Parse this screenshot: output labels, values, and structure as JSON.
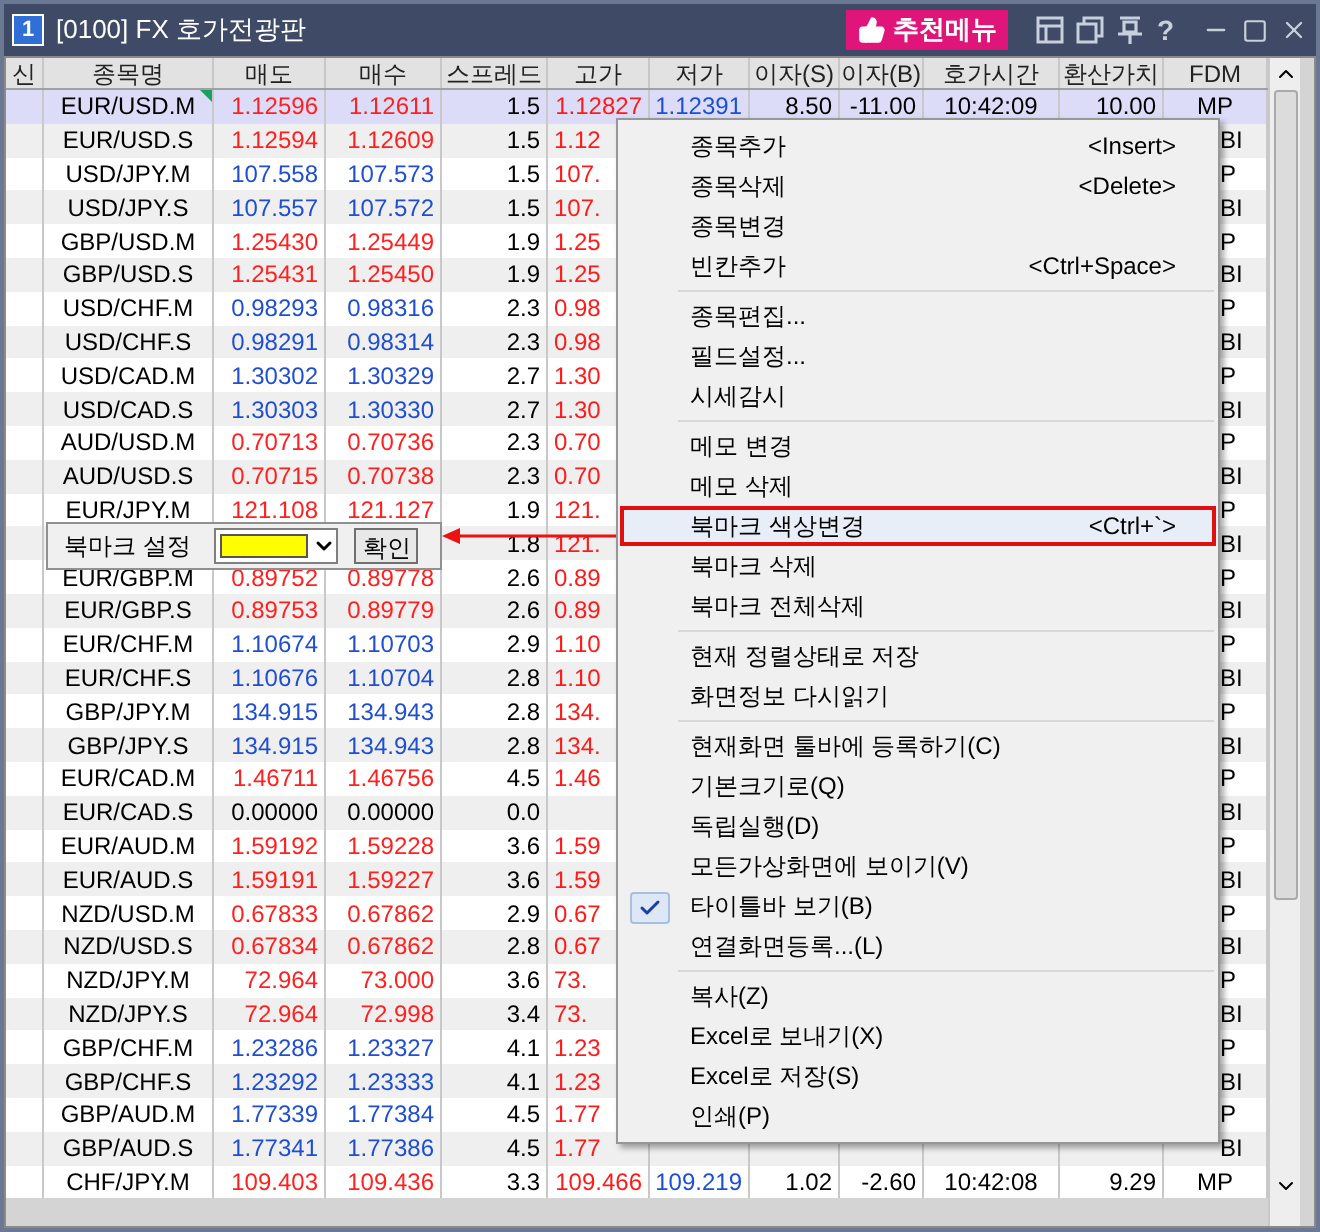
{
  "window": {
    "number": "1",
    "title": "[0100] FX 호가전광판",
    "recommend_button": "추천메뉴",
    "help_glyph": "?"
  },
  "table": {
    "columns": [
      "신",
      "종목명",
      "매도",
      "매수",
      "스프레드",
      "고가",
      "저가",
      "이자(S)",
      "이자(B)",
      "호가시간",
      "환산가치",
      "FDM"
    ],
    "rows": [
      {
        "name": "EUR/USD.M",
        "sell": "1.12596",
        "buy": "1.12611",
        "spread": "1.5",
        "high": "1.12827",
        "low": "1.12391",
        "int_s": "8.50",
        "int_b": "-11.00",
        "time": "10:42:09",
        "value": "10.00",
        "fdm": "MP",
        "color": "#ff2020",
        "selected": true,
        "memo": true
      },
      {
        "name": "EUR/USD.S",
        "sell": "1.12594",
        "buy": "1.12609",
        "spread": "1.5",
        "high": "1.12",
        "fdm": "BI",
        "color": "#ff2020",
        "selected": false,
        "memo": false
      },
      {
        "name": "USD/JPY.M",
        "sell": "107.558",
        "buy": "107.573",
        "spread": "1.5",
        "high": "107.",
        "fdm": "P",
        "color": "#1f4fd0",
        "selected": false,
        "memo": false
      },
      {
        "name": "USD/JPY.S",
        "sell": "107.557",
        "buy": "107.572",
        "spread": "1.5",
        "high": "107.",
        "fdm": "BI",
        "color": "#1f4fd0",
        "selected": false,
        "memo": false
      },
      {
        "name": "GBP/USD.M",
        "sell": "1.25430",
        "buy": "1.25449",
        "spread": "1.9",
        "high": "1.25",
        "fdm": "P",
        "color": "#ff2020",
        "selected": false,
        "memo": false
      },
      {
        "name": "GBP/USD.S",
        "sell": "1.25431",
        "buy": "1.25450",
        "spread": "1.9",
        "high": "1.25",
        "fdm": "BI",
        "color": "#ff2020",
        "selected": false,
        "memo": false
      },
      {
        "name": "USD/CHF.M",
        "sell": "0.98293",
        "buy": "0.98316",
        "spread": "2.3",
        "high": "0.98",
        "fdm": "P",
        "color": "#1f4fd0",
        "selected": false,
        "memo": false
      },
      {
        "name": "USD/CHF.S",
        "sell": "0.98291",
        "buy": "0.98314",
        "spread": "2.3",
        "high": "0.98",
        "fdm": "BI",
        "color": "#1f4fd0",
        "selected": false,
        "memo": false
      },
      {
        "name": "USD/CAD.M",
        "sell": "1.30302",
        "buy": "1.30329",
        "spread": "2.7",
        "high": "1.30",
        "fdm": "P",
        "color": "#1f4fd0",
        "selected": false,
        "memo": false
      },
      {
        "name": "USD/CAD.S",
        "sell": "1.30303",
        "buy": "1.30330",
        "spread": "2.7",
        "high": "1.30",
        "fdm": "BI",
        "color": "#1f4fd0",
        "selected": false,
        "memo": false
      },
      {
        "name": "AUD/USD.M",
        "sell": "0.70713",
        "buy": "0.70736",
        "spread": "2.3",
        "high": "0.70",
        "fdm": "P",
        "color": "#ff2020",
        "selected": false,
        "memo": false
      },
      {
        "name": "AUD/USD.S",
        "sell": "0.70715",
        "buy": "0.70738",
        "spread": "2.3",
        "high": "0.70",
        "fdm": "BI",
        "color": "#ff2020",
        "selected": false,
        "memo": false
      },
      {
        "name": "EUR/JPY.M",
        "sell": "121.108",
        "buy": "121.127",
        "spread": "1.9",
        "high": "121.",
        "fdm": "P",
        "color": "#ff2020",
        "selected": false,
        "memo": false
      },
      {
        "spread": "1.8",
        "high": "121.",
        "fdm": "BI",
        "selected": false,
        "memo": false
      },
      {
        "name": "EUR/GBP.M",
        "sell": "0.89752",
        "buy": "0.89778",
        "spread": "2.6",
        "high": "0.89",
        "fdm": "P",
        "color": "#ff2020",
        "selected": false,
        "memo": false
      },
      {
        "name": "EUR/GBP.S",
        "sell": "0.89753",
        "buy": "0.89779",
        "spread": "2.6",
        "high": "0.89",
        "fdm": "BI",
        "color": "#ff2020",
        "selected": false,
        "memo": false
      },
      {
        "name": "EUR/CHF.M",
        "sell": "1.10674",
        "buy": "1.10703",
        "spread": "2.9",
        "high": "1.10",
        "fdm": "P",
        "color": "#1f4fd0",
        "selected": false,
        "memo": false
      },
      {
        "name": "EUR/CHF.S",
        "sell": "1.10676",
        "buy": "1.10704",
        "spread": "2.8",
        "high": "1.10",
        "fdm": "BI",
        "color": "#1f4fd0",
        "selected": false,
        "memo": false
      },
      {
        "name": "GBP/JPY.M",
        "sell": "134.915",
        "buy": "134.943",
        "spread": "2.8",
        "high": "134.",
        "fdm": "P",
        "color": "#1f4fd0",
        "selected": false,
        "memo": false
      },
      {
        "name": "GBP/JPY.S",
        "sell": "134.915",
        "buy": "134.943",
        "spread": "2.8",
        "high": "134.",
        "fdm": "BI",
        "color": "#1f4fd0",
        "selected": false,
        "memo": false
      },
      {
        "name": "EUR/CAD.M",
        "sell": "1.46711",
        "buy": "1.46756",
        "spread": "4.5",
        "high": "1.46",
        "fdm": "P",
        "color": "#ff2020",
        "selected": false,
        "memo": false
      },
      {
        "name": "EUR/CAD.S",
        "sell": "0.00000",
        "buy": "0.00000",
        "spread": "0.0",
        "fdm": "BI",
        "color": "#000000",
        "selected": false,
        "memo": false
      },
      {
        "name": "EUR/AUD.M",
        "sell": "1.59192",
        "buy": "1.59228",
        "spread": "3.6",
        "high": "1.59",
        "fdm": "P",
        "color": "#ff2020",
        "selected": false,
        "memo": false
      },
      {
        "name": "EUR/AUD.S",
        "sell": "1.59191",
        "buy": "1.59227",
        "spread": "3.6",
        "high": "1.59",
        "fdm": "BI",
        "color": "#ff2020",
        "selected": false,
        "memo": false
      },
      {
        "name": "NZD/USD.M",
        "sell": "0.67833",
        "buy": "0.67862",
        "spread": "2.9",
        "high": "0.67",
        "fdm": "P",
        "color": "#ff2020",
        "selected": false,
        "memo": false
      },
      {
        "name": "NZD/USD.S",
        "sell": "0.67834",
        "buy": "0.67862",
        "spread": "2.8",
        "high": "0.67",
        "fdm": "BI",
        "color": "#ff2020",
        "selected": false,
        "memo": false
      },
      {
        "name": "NZD/JPY.M",
        "sell": "72.964",
        "buy": "73.000",
        "spread": "3.6",
        "high": "73.",
        "fdm": "P",
        "color": "#ff2020",
        "selected": false,
        "memo": false
      },
      {
        "name": "NZD/JPY.S",
        "sell": "72.964",
        "buy": "72.998",
        "spread": "3.4",
        "high": "73.",
        "fdm": "BI",
        "color": "#ff2020",
        "selected": false,
        "memo": false
      },
      {
        "name": "GBP/CHF.M",
        "sell": "1.23286",
        "buy": "1.23327",
        "spread": "4.1",
        "high": "1.23",
        "fdm": "P",
        "color": "#1f4fd0",
        "selected": false,
        "memo": false
      },
      {
        "name": "GBP/CHF.S",
        "sell": "1.23292",
        "buy": "1.23333",
        "spread": "4.1",
        "high": "1.23",
        "fdm": "BI",
        "color": "#1f4fd0",
        "selected": false,
        "memo": false
      },
      {
        "name": "GBP/AUD.M",
        "sell": "1.77339",
        "buy": "1.77384",
        "spread": "4.5",
        "high": "1.77",
        "fdm": "P",
        "color": "#1f4fd0",
        "selected": false,
        "memo": false
      },
      {
        "name": "GBP/AUD.S",
        "sell": "1.77341",
        "buy": "1.77386",
        "spread": "4.5",
        "high": "1.77",
        "fdm": "BI",
        "color": "#1f4fd0",
        "selected": false,
        "memo": false
      },
      {
        "name": "CHF/JPY.M",
        "sell": "109.403",
        "buy": "109.436",
        "spread": "3.3",
        "high": "109.466",
        "low": "109.219",
        "int_s": "1.02",
        "int_b": "-2.60",
        "time": "10:42:08",
        "value": "9.29",
        "fdm": "MP",
        "color": "#ff2020",
        "selected": false,
        "memo": false
      }
    ]
  },
  "bookmark_popup": {
    "label": "북마크 설정",
    "color": "#ffff00",
    "confirm": "확인"
  },
  "context_menu": [
    [
      {
        "label": "종목추가",
        "shortcut": "<Insert>",
        "checked": false,
        "selected": false
      },
      {
        "label": "종목삭제",
        "shortcut": "<Delete>",
        "checked": false,
        "selected": false
      },
      {
        "label": "종목변경",
        "checked": false,
        "selected": false
      },
      {
        "label": "빈칸추가",
        "shortcut": "<Ctrl+Space>",
        "checked": false,
        "selected": false
      }
    ],
    [
      {
        "label": "종목편집...",
        "checked": false,
        "selected": false
      },
      {
        "label": "필드설정...",
        "checked": false,
        "selected": false
      },
      {
        "label": "시세감시",
        "checked": false,
        "selected": false
      }
    ],
    [
      {
        "label": "메모 변경",
        "checked": false,
        "selected": false
      },
      {
        "label": "메모 삭제",
        "checked": false,
        "selected": false
      },
      {
        "label": "북마크 색상변경",
        "shortcut": "<Ctrl+`>",
        "checked": false,
        "selected": true
      },
      {
        "label": "북마크 삭제",
        "checked": false,
        "selected": false
      },
      {
        "label": "북마크 전체삭제",
        "checked": false,
        "selected": false
      }
    ],
    [
      {
        "label": "현재 정렬상태로 저장",
        "checked": false,
        "selected": false
      },
      {
        "label": "화면정보 다시읽기",
        "checked": false,
        "selected": false
      }
    ],
    [
      {
        "label": "현재화면 툴바에 등록하기(C)",
        "checked": false,
        "selected": false
      },
      {
        "label": "기본크기로(Q)",
        "checked": false,
        "selected": false
      },
      {
        "label": "독립실행(D)",
        "checked": false,
        "selected": false
      },
      {
        "label": "모든가상화면에 보이기(V)",
        "checked": false,
        "selected": false
      },
      {
        "label": "타이틀바 보기(B)",
        "checked": true,
        "selected": false
      },
      {
        "label": "연결화면등록...(L)",
        "checked": false,
        "selected": false
      }
    ],
    [
      {
        "label": "복사(Z)",
        "checked": false,
        "selected": false
      },
      {
        "label": "Excel로 보내기(X)",
        "checked": false,
        "selected": false
      },
      {
        "label": "Excel로 저장(S)",
        "checked": false,
        "selected": false
      },
      {
        "label": "인쇄(P)",
        "checked": false,
        "selected": false
      }
    ]
  ]
}
